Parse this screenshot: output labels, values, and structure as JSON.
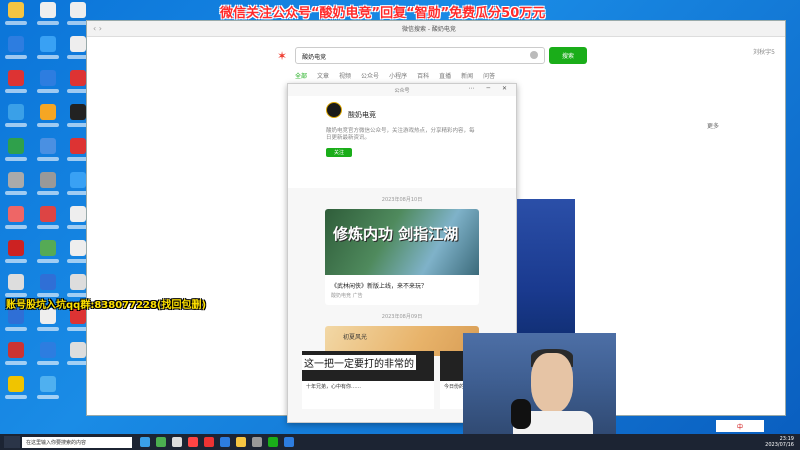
{
  "banner": {
    "text": "微信关注公众号“酸奶电竞”回复“智勋”免费瓜分50万元"
  },
  "stream_overlay": {
    "text": "账号股坑入坑qq群:838077228(找回包删)"
  },
  "subtitle": {
    "text": "这一把一定要打的非常的"
  },
  "browser": {
    "title": "微信搜索 - 酸奶电竞",
    "search": {
      "value": "酸奶电竞",
      "button_label": "搜索"
    },
    "tabs": [
      "全部",
      "文章",
      "视频",
      "公众号",
      "小程序",
      "百科",
      "直播",
      "新闻",
      "问答"
    ],
    "active_tab": "全部",
    "right_user": "刘秋宇5",
    "right_panel_label": "更多"
  },
  "popup": {
    "header": "公众号",
    "controls": "⋯ ─ ✕",
    "profile": {
      "name": "酸奶电竞",
      "description": "酸奶电竞官方微信公众号，关注游戏热点，分享精彩内容，每日更新最新资讯。",
      "follow_label": "关注"
    },
    "date_1": "2023年08月10日",
    "article_1": {
      "image_text": "修炼内功 剑指江湖",
      "title": "《武林闲侠》新版上线，来不来玩？",
      "meta": "酸奶电竞 广告"
    },
    "date_2": "2023年08月09日",
    "article_2": {
      "image_text": "初夏风光"
    }
  },
  "videos": [
    {
      "caption": "十年兄弟，心中有你……"
    },
    {
      "caption": "今日份的心情"
    }
  ],
  "taskbar": {
    "search_placeholder": "在这里输入你要搜索的内容",
    "time": "23:19",
    "date": "2023/07/16",
    "ime": "中"
  }
}
